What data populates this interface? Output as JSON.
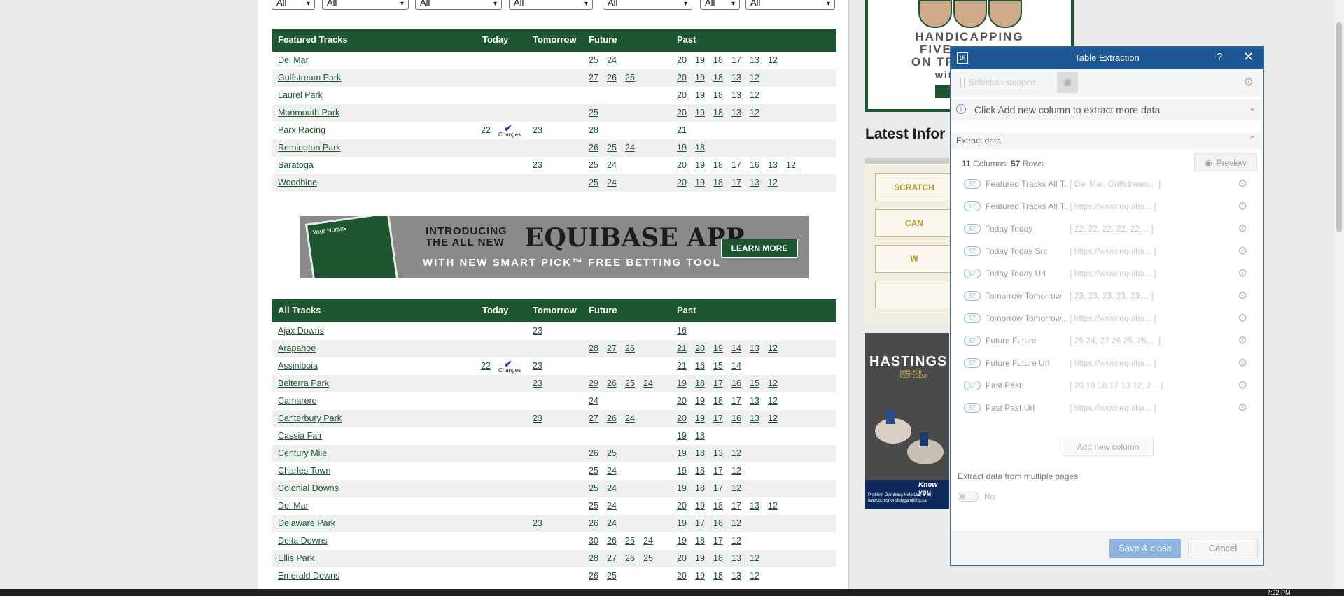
{
  "filters": [
    {
      "value": "All"
    },
    {
      "value": "All"
    },
    {
      "value": "All"
    },
    {
      "value": "All"
    },
    {
      "value": "All"
    },
    {
      "value": "All"
    },
    {
      "value": "All"
    }
  ],
  "featured": {
    "headers": {
      "name": "Featured Tracks",
      "today": "Today",
      "tomorrow": "Tomorrow",
      "future": "Future",
      "past": "Past"
    },
    "rows": [
      {
        "name": "Del Mar",
        "today": "",
        "changes": false,
        "tomorrow": "",
        "future": [
          "25",
          "24"
        ],
        "past": [
          "20",
          "19",
          "18",
          "17",
          "13",
          "12"
        ]
      },
      {
        "name": "Gulfstream Park",
        "today": "",
        "changes": false,
        "tomorrow": "",
        "future": [
          "27",
          "26",
          "25"
        ],
        "past": [
          "20",
          "19",
          "18",
          "13",
          "12"
        ]
      },
      {
        "name": "Laurel Park",
        "today": "",
        "changes": false,
        "tomorrow": "",
        "future": [],
        "past": [
          "20",
          "19",
          "18",
          "13",
          "12"
        ]
      },
      {
        "name": "Monmouth Park",
        "today": "",
        "changes": false,
        "tomorrow": "",
        "future": [
          "25"
        ],
        "past": [
          "20",
          "19",
          "18",
          "13",
          "12"
        ]
      },
      {
        "name": "Parx Racing",
        "today": "22",
        "changes": true,
        "tomorrow": "23",
        "future": [
          "28"
        ],
        "past": [
          "21"
        ]
      },
      {
        "name": "Remington Park",
        "today": "",
        "changes": false,
        "tomorrow": "",
        "future": [
          "26",
          "25",
          "24"
        ],
        "past": [
          "19",
          "18"
        ]
      },
      {
        "name": "Saratoga",
        "today": "",
        "changes": false,
        "tomorrow": "23",
        "future": [
          "25",
          "24"
        ],
        "past": [
          "20",
          "19",
          "18",
          "17",
          "16",
          "13",
          "12"
        ]
      },
      {
        "name": "Woodbine",
        "today": "",
        "changes": false,
        "tomorrow": "",
        "future": [
          "25",
          "24"
        ],
        "past": [
          "20",
          "19",
          "18",
          "17",
          "13",
          "12"
        ]
      }
    ]
  },
  "changes_label": "Changes",
  "banner": {
    "line1a": "INTRODUCING",
    "line1b": "THE ALL NEW",
    "headline": "EQUIBASE APP",
    "line3": "WITH NEW SMART PICK™ FREE BETTING TOOL",
    "button": "LEARN MORE",
    "card_text": "Your Horses"
  },
  "all": {
    "headers": {
      "name": "All Tracks",
      "today": "Today",
      "tomorrow": "Tomorrow",
      "future": "Future",
      "past": "Past"
    },
    "rows": [
      {
        "name": "Ajax Downs",
        "today": "",
        "changes": false,
        "tomorrow": "23",
        "future": [],
        "past": [
          "16"
        ]
      },
      {
        "name": "Arapahoe",
        "today": "",
        "changes": false,
        "tomorrow": "",
        "future": [
          "28",
          "27",
          "26"
        ],
        "past": [
          "21",
          "20",
          "19",
          "14",
          "13",
          "12"
        ]
      },
      {
        "name": "Assiniboia",
        "today": "22",
        "changes": true,
        "tomorrow": "23",
        "future": [],
        "past": [
          "21",
          "16",
          "15",
          "14"
        ]
      },
      {
        "name": "Belterra Park",
        "today": "",
        "changes": false,
        "tomorrow": "23",
        "future": [
          "29",
          "26",
          "25",
          "24"
        ],
        "past": [
          "19",
          "18",
          "17",
          "16",
          "15",
          "12"
        ]
      },
      {
        "name": "Camarero",
        "today": "",
        "changes": false,
        "tomorrow": "",
        "future": [
          "24"
        ],
        "past": [
          "20",
          "19",
          "18",
          "17",
          "13",
          "12"
        ]
      },
      {
        "name": "Canterbury Park",
        "today": "",
        "changes": false,
        "tomorrow": "23",
        "future": [
          "27",
          "26",
          "24"
        ],
        "past": [
          "20",
          "19",
          "17",
          "16",
          "13",
          "12"
        ]
      },
      {
        "name": "Cassia Fair",
        "today": "",
        "changes": false,
        "tomorrow": "",
        "future": [],
        "past": [
          "19",
          "18"
        ]
      },
      {
        "name": "Century Mile",
        "today": "",
        "changes": false,
        "tomorrow": "",
        "future": [
          "26",
          "25"
        ],
        "past": [
          "19",
          "18",
          "13",
          "12"
        ]
      },
      {
        "name": "Charles Town",
        "today": "",
        "changes": false,
        "tomorrow": "",
        "future": [
          "25",
          "24"
        ],
        "past": [
          "19",
          "18",
          "17",
          "12"
        ]
      },
      {
        "name": "Colonial Downs",
        "today": "",
        "changes": false,
        "tomorrow": "",
        "future": [
          "25",
          "24"
        ],
        "past": [
          "19",
          "18",
          "17",
          "12"
        ]
      },
      {
        "name": "Del Mar",
        "today": "",
        "changes": false,
        "tomorrow": "",
        "future": [
          "25",
          "24"
        ],
        "past": [
          "20",
          "19",
          "18",
          "17",
          "13",
          "12"
        ]
      },
      {
        "name": "Delaware Park",
        "today": "",
        "changes": false,
        "tomorrow": "23",
        "future": [
          "26",
          "24"
        ],
        "past": [
          "19",
          "17",
          "16",
          "12"
        ]
      },
      {
        "name": "Delta Downs",
        "today": "",
        "changes": false,
        "tomorrow": "",
        "future": [
          "30",
          "26",
          "25",
          "24"
        ],
        "past": [
          "19",
          "18",
          "17",
          "12"
        ]
      },
      {
        "name": "Ellis Park",
        "today": "",
        "changes": false,
        "tomorrow": "",
        "future": [
          "28",
          "27",
          "26",
          "25"
        ],
        "past": [
          "20",
          "19",
          "18",
          "13",
          "12"
        ]
      },
      {
        "name": "Emerald Downs",
        "today": "",
        "changes": false,
        "tomorrow": "",
        "future": [
          "26",
          "25"
        ],
        "past": [
          "20",
          "19",
          "18",
          "13",
          "12"
        ]
      }
    ]
  },
  "ad1": {
    "l1": "HANDICAPPING",
    "l2": "FIVE",
    "l3": "ON TR",
    "l4": "with",
    "btn": "RE"
  },
  "latest": {
    "title": "Latest Infor"
  },
  "info_buttons": [
    {
      "label": "SCRATCH"
    },
    {
      "label": "CAN"
    },
    {
      "label": "W"
    },
    {
      "label": ""
    }
  ],
  "ad2": {
    "title": "HASTINGS",
    "sub": "BRED FOR EXCITEMENT",
    "know": "Know you",
    "line1": "Problem Gambling Help Line 1-88",
    "line2": "www.bcresponsiblegambling.ca"
  },
  "clock": "7:22 PM",
  "panel": {
    "title": "Table Extraction",
    "help": "?",
    "close": "✕",
    "status": "Selection stopped",
    "info": "Click Add new column to extract more data",
    "section": "Extract data",
    "columns_count": "11",
    "columns_word": "Columns",
    "rows_count": "57",
    "rows_word": "Rows",
    "preview": "Preview",
    "columns": [
      {
        "count": "57",
        "name": "Featured Tracks All T...",
        "preview": "[ Del Mar, Gulfstream... ]"
      },
      {
        "count": "57",
        "name": "Featured Tracks All T...",
        "preview": "[ https://www.equiba... ]"
      },
      {
        "count": "57",
        "name": "Today Today",
        "preview": "[ 22, 22, 22, 22, 22,... ]"
      },
      {
        "count": "57",
        "name": "Today Today Src",
        "preview": "[ https://www.equiba... ]"
      },
      {
        "count": "57",
        "name": "Today Today Url",
        "preview": "[ https://www.equiba... ]"
      },
      {
        "count": "57",
        "name": "Tomorrow Tomorrow",
        "preview": "[ 23, 23, 23, 23, 23,... ]"
      },
      {
        "count": "57",
        "name": "Tomorrow Tomorrow...",
        "preview": "[ https://www.equiba... ]"
      },
      {
        "count": "57",
        "name": "Future Future",
        "preview": "[ 25 24, 27 26 25, 25,... ]"
      },
      {
        "count": "57",
        "name": "Future Future Url",
        "preview": "[ https://www.equiba... ]"
      },
      {
        "count": "57",
        "name": "Past Past",
        "preview": "[ 20 19 18 17 13 12, 2... ]"
      },
      {
        "count": "57",
        "name": "Past Past Url",
        "preview": "[ https://www.equiba... ]"
      }
    ],
    "add_column": "Add new column",
    "multi_pages": "Extract data from multiple pages",
    "toggle": "No",
    "save": "Save & close",
    "cancel": "Cancel"
  }
}
